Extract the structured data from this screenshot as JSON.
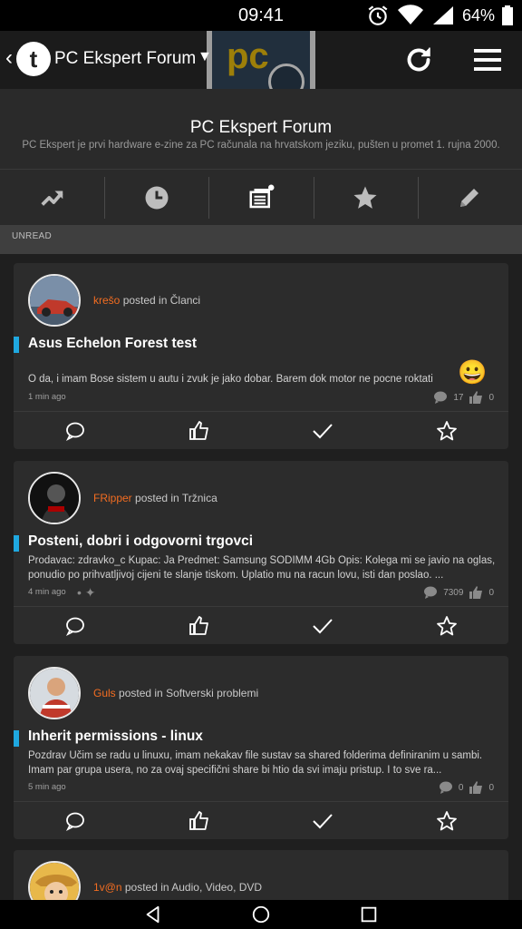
{
  "status_bar": {
    "time": "09:41",
    "battery": "64%"
  },
  "app_bar": {
    "title": "PC Ekspert Forum",
    "logo_letter": "t",
    "banner_text": "pc"
  },
  "forum_header": {
    "title": "PC Ekspert Forum",
    "subtitle": "PC Ekspert je prvi hardware e-zine za PC računala na hrvatskom jeziku, pušten u promet 1. rujna 2000."
  },
  "tabs": [
    {
      "name": "trending-icon"
    },
    {
      "name": "clock-icon"
    },
    {
      "name": "unread-icon"
    },
    {
      "name": "star-icon"
    },
    {
      "name": "pencil-icon"
    }
  ],
  "section_label": "UNREAD",
  "posts": [
    {
      "author": "krešo",
      "posted_in": "posted in",
      "forum": "Članci",
      "title": "Asus Echelon Forest test",
      "snippet": "O da, i imam Bose sistem u autu i zvuk je jako dobar. Barem dok motor ne pocne roktati",
      "time": "1 min ago",
      "replies": "17",
      "likes": "0",
      "emoji": "😀"
    },
    {
      "author": "FRipper",
      "posted_in": "posted in",
      "forum": "Tržnica",
      "title": "Posteni, dobri i odgovorni trgovci",
      "snippet": "Prodavac: zdravko_c Kupac: Ja Predmet: Samsung SODIMM 4Gb Opis: Kolega mi se javio na oglas, ponudio po prihvatljivoj cijeni te slanje tiskom. Uplatio mu na racun lovu, isti dan poslao. ...",
      "time": "4 min ago",
      "replies": "7309",
      "likes": "0"
    },
    {
      "author": "Guls",
      "posted_in": "posted in",
      "forum": "Softverski problemi",
      "title": "Inherit permissions - linux",
      "snippet": "Pozdrav Učim se radu u linuxu, imam nekakav file sustav sa shared folderima definiranim u sambi. Imam par grupa usera, no za ovaj specifični share bi htio da svi imaju pristup. I to sve ra...",
      "time": "5 min ago",
      "replies": "0",
      "likes": "0"
    },
    {
      "author": "1v@n",
      "posted_in": "posted in",
      "forum": "Audio, Video, DVD"
    }
  ],
  "colors": {
    "accent_orange": "#f36d21",
    "accent_blue": "#1fa8e0",
    "card_bg": "#2c2c2c",
    "page_bg": "#1f1f1f"
  }
}
